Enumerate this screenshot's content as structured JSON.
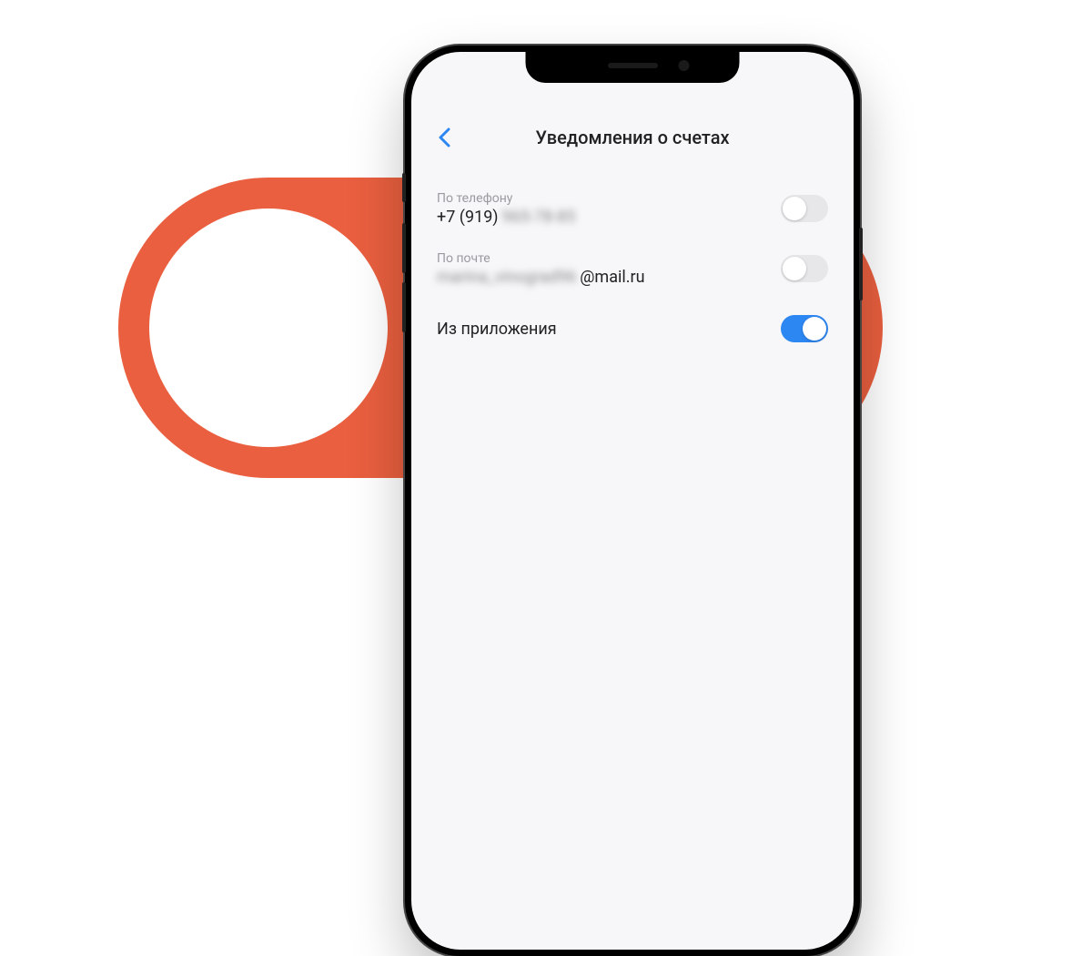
{
  "header": {
    "title": "Уведомления о счетах"
  },
  "rows": [
    {
      "label": "По телефону",
      "value_prefix": "+7 (919)",
      "value_blurred": "965-78-85",
      "toggle": false
    },
    {
      "label": "По почте",
      "value_blurred_prefix": "marina_vinograd96",
      "value_suffix": "@mail.ru",
      "toggle": false
    },
    {
      "label": "Из приложения",
      "toggle": true
    }
  ]
}
